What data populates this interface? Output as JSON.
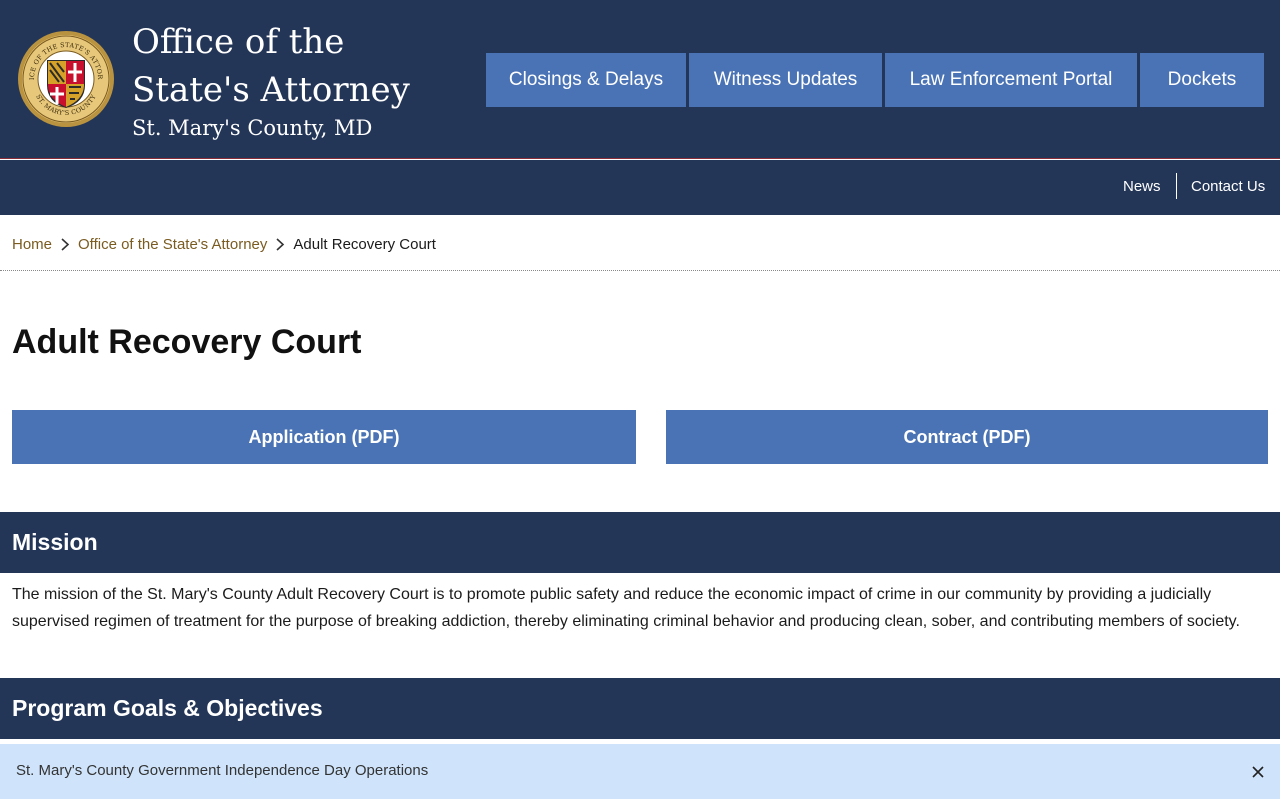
{
  "header": {
    "title": "Office of the State's Attorney",
    "subtitle": "St. Mary's County, MD",
    "seal": {
      "icon": "county-seal-icon",
      "text_top": "OFFICE OF THE STATE'S ATTORNEY",
      "text_bottom": "ST. MARY'S COUNTY"
    },
    "buttons": [
      {
        "label": "Closings & Delays"
      },
      {
        "label": "Witness Updates"
      },
      {
        "label": "Law Enforcement Portal"
      },
      {
        "label": "Dockets"
      }
    ]
  },
  "subnav": {
    "items": [
      {
        "label": "News"
      },
      {
        "label": "Contact Us"
      }
    ]
  },
  "breadcrumb": {
    "items": [
      {
        "label": "Home"
      },
      {
        "label": "Office of the State's Attorney"
      },
      {
        "label": "Adult Recovery Court"
      }
    ],
    "separator_icon": "chevron-right-icon"
  },
  "page": {
    "title": "Adult Recovery Court",
    "buttons": [
      {
        "label": "Application (PDF)"
      },
      {
        "label": "Contract (PDF)"
      }
    ]
  },
  "sections": {
    "mission": {
      "heading": "Mission",
      "body": "The mission of the St. Mary's County Adult Recovery Court is to promote public safety and reduce the economic impact of crime in our community by providing a judicially supervised regimen of treatment for the purpose of breaking addiction, thereby eliminating criminal behavior and producing clean, sober, and contributing members of society."
    },
    "goals": {
      "heading": "Program Goals & Objectives"
    }
  },
  "alert": {
    "text": "St. Mary's County Government Independence Day Operations",
    "close_icon": "close-icon"
  },
  "colors": {
    "navy": "#243658",
    "button_blue": "#4a73b5",
    "breadcrumb_link": "#7a5c21",
    "alert_bg": "#cfe4fb"
  }
}
